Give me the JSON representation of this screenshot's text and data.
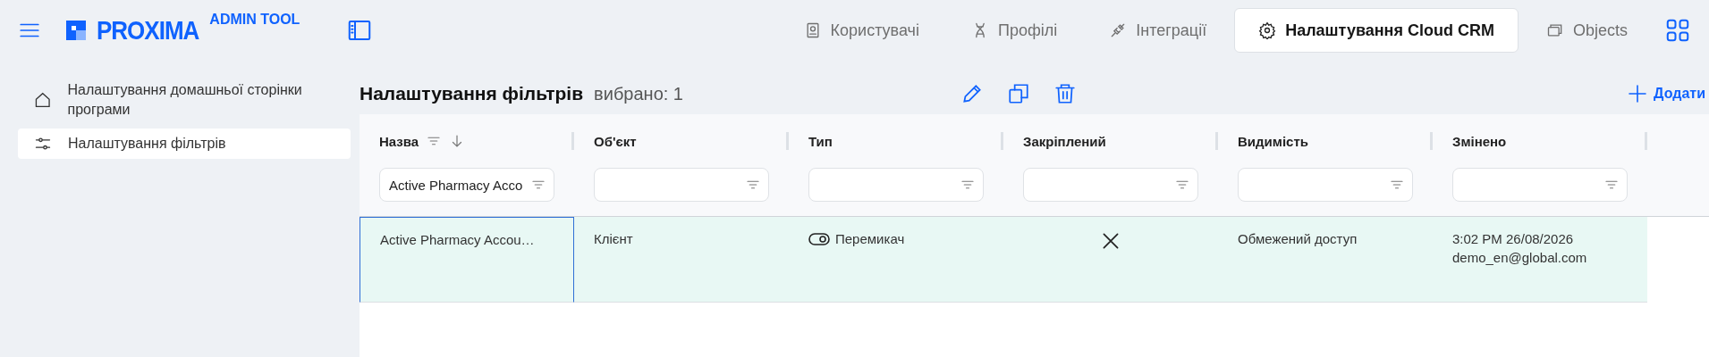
{
  "header": {
    "logo": "PROXIMA",
    "subtitle": "ADMIN TOOL"
  },
  "nav_tabs": [
    {
      "label": "Користувачі",
      "selected": false
    },
    {
      "label": "Профілі",
      "selected": false
    },
    {
      "label": "Інтеграції",
      "selected": false
    },
    {
      "label": "Налаштування Cloud CRM",
      "selected": true
    },
    {
      "label": "Objects",
      "selected": false
    }
  ],
  "sidebar": {
    "items": [
      {
        "label": "Налаштування домашньої сторінки програми",
        "selected": false
      },
      {
        "label": "Налаштування фільтрів",
        "selected": true
      }
    ]
  },
  "page": {
    "title": "Налаштування фільтрів",
    "selection": "вибрано: 1",
    "add_button": "Додати"
  },
  "table": {
    "columns": [
      {
        "label": "Назва",
        "filter_value": "Active Pharmacy Acco"
      },
      {
        "label": "Об'єкт"
      },
      {
        "label": "Тип"
      },
      {
        "label": "Закріплений"
      },
      {
        "label": "Видимість"
      },
      {
        "label": "Змінено"
      }
    ],
    "rows": [
      {
        "selected": true,
        "name": "Active Pharmacy Accou…",
        "object": "Клієнт",
        "type": "Перемикач",
        "pinned": false,
        "visibility": "Обмежений доступ",
        "modified": "3:02 PM 26/08/2026",
        "modified_by": "demo_en@global.com"
      }
    ]
  }
}
